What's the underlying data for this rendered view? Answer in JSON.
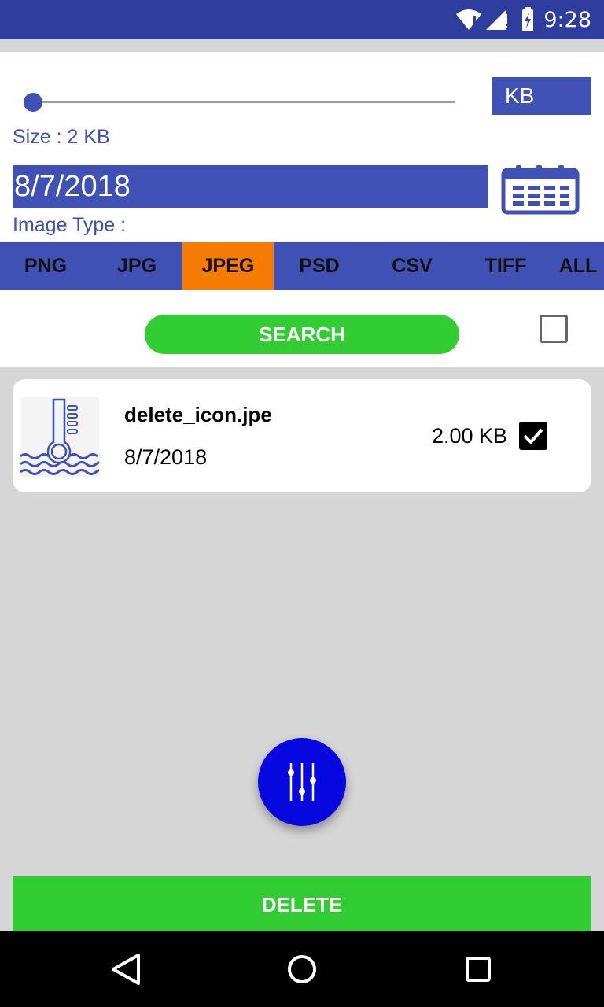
{
  "status_bar": {
    "time": "9:28",
    "icons": [
      "wifi-icon",
      "signal-icon",
      "battery-charging-icon"
    ]
  },
  "filters": {
    "size_slider_value": 2,
    "size_unit": "KB",
    "size_label": "Size : 2 KB",
    "date": "8/7/2018",
    "calendar_icon": "calendar-icon",
    "image_type_label": "Image Type :",
    "image_types": [
      {
        "label": "PNG",
        "active": false
      },
      {
        "label": "JPG",
        "active": false
      },
      {
        "label": "JPEG",
        "active": true
      },
      {
        "label": "PSD",
        "active": false
      },
      {
        "label": "CSV",
        "active": false
      },
      {
        "label": "TIFF",
        "active": false
      },
      {
        "label": "ALL",
        "active": false
      }
    ],
    "search_label": "SEARCH",
    "select_all_checked": false
  },
  "results": [
    {
      "name": "delete_icon.jpe",
      "date": "8/7/2018",
      "size": "2.00 KB",
      "checked": true,
      "thumbnail_icon": "thermometer-icon"
    }
  ],
  "fab": {
    "icon": "equalizer-icon"
  },
  "actions": {
    "delete_label": "DELETE"
  },
  "nav_bar": {
    "icons": [
      "back-icon",
      "home-icon",
      "recents-icon"
    ]
  },
  "colors": {
    "primary": "#3f51b5",
    "status_bar": "#2f3d9e",
    "accent_orange": "#f57c00",
    "green": "#32cd32",
    "fab_blue": "#0707e0",
    "background": "#d6d6d6"
  }
}
